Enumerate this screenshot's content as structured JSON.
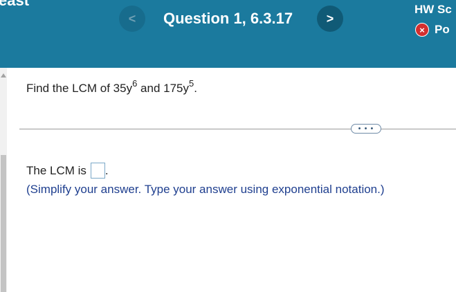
{
  "header": {
    "cut_left_text": "east",
    "question_title": "Question 1, 6.3.17",
    "prev_icon": "<",
    "next_icon": ">",
    "hw_label": "HW Sc",
    "status_icon": "×",
    "status_label": "Po"
  },
  "question": {
    "prefix": "Find the LCM of 35y",
    "exp1": "6",
    "middle": " and 175y",
    "exp2": "5",
    "suffix": "."
  },
  "more_button": "• • •",
  "answer": {
    "label": "The LCM is",
    "value": "",
    "suffix": "."
  },
  "hint": "(Simplify your answer. Type your answer using exponential notation.)",
  "colors": {
    "header_bg": "#1b7a9e",
    "hint_text": "#1f3f8f",
    "status_icon": "#d32f2f"
  }
}
